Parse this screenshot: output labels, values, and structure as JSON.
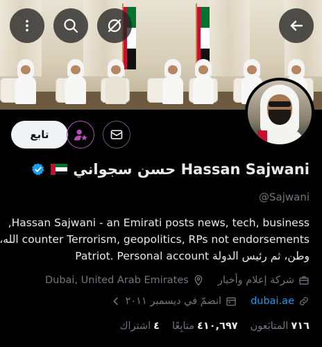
{
  "profile": {
    "name": "حسن سجواني Hassan Sajwani",
    "handle": "@Sajwani",
    "bio_lines": [
      "Hassan Sajwani - an Emirati posts news, tech, business,",
      "counter Terrorism, geopolitics, RPs not endorsements الله،",
      "وطن، ثم رئيس الدولة Patriot. Personal account"
    ],
    "category": "شركة إعلام وأخبار",
    "location": "Dubai, United Arab Emirates",
    "website": "dubai.ae",
    "joined": "انضمّ في ديسمبر ٢٠١١",
    "following_count": "٧١٦",
    "following_label": "المتابَعون",
    "followers_count": "٤١٠,٦٩٧",
    "followers_label": "متابِعًا",
    "subscriptions_count": "٤",
    "subscriptions_label": "اشتراك"
  },
  "actions": {
    "follow_label": "تابع"
  },
  "icons": {
    "back": "arrow-left-icon",
    "search": "search-icon",
    "mute": "slash-icon",
    "more": "more-vertical-icon",
    "subscribe": "person-star-icon",
    "message": "envelope-icon",
    "verified": "verified-badge-icon",
    "flag": "uae-flag-icon",
    "category": "briefcase-icon",
    "location": "location-pin-icon",
    "link": "link-icon",
    "calendar": "calendar-icon",
    "chevron": "chevron-left-icon"
  },
  "colors": {
    "background": "#000000",
    "text": "#e7e9ea",
    "muted": "#71767b",
    "link": "#1d9bf0",
    "subscribe_ring": "#b54fb8",
    "verified": "#1d9bf0"
  }
}
